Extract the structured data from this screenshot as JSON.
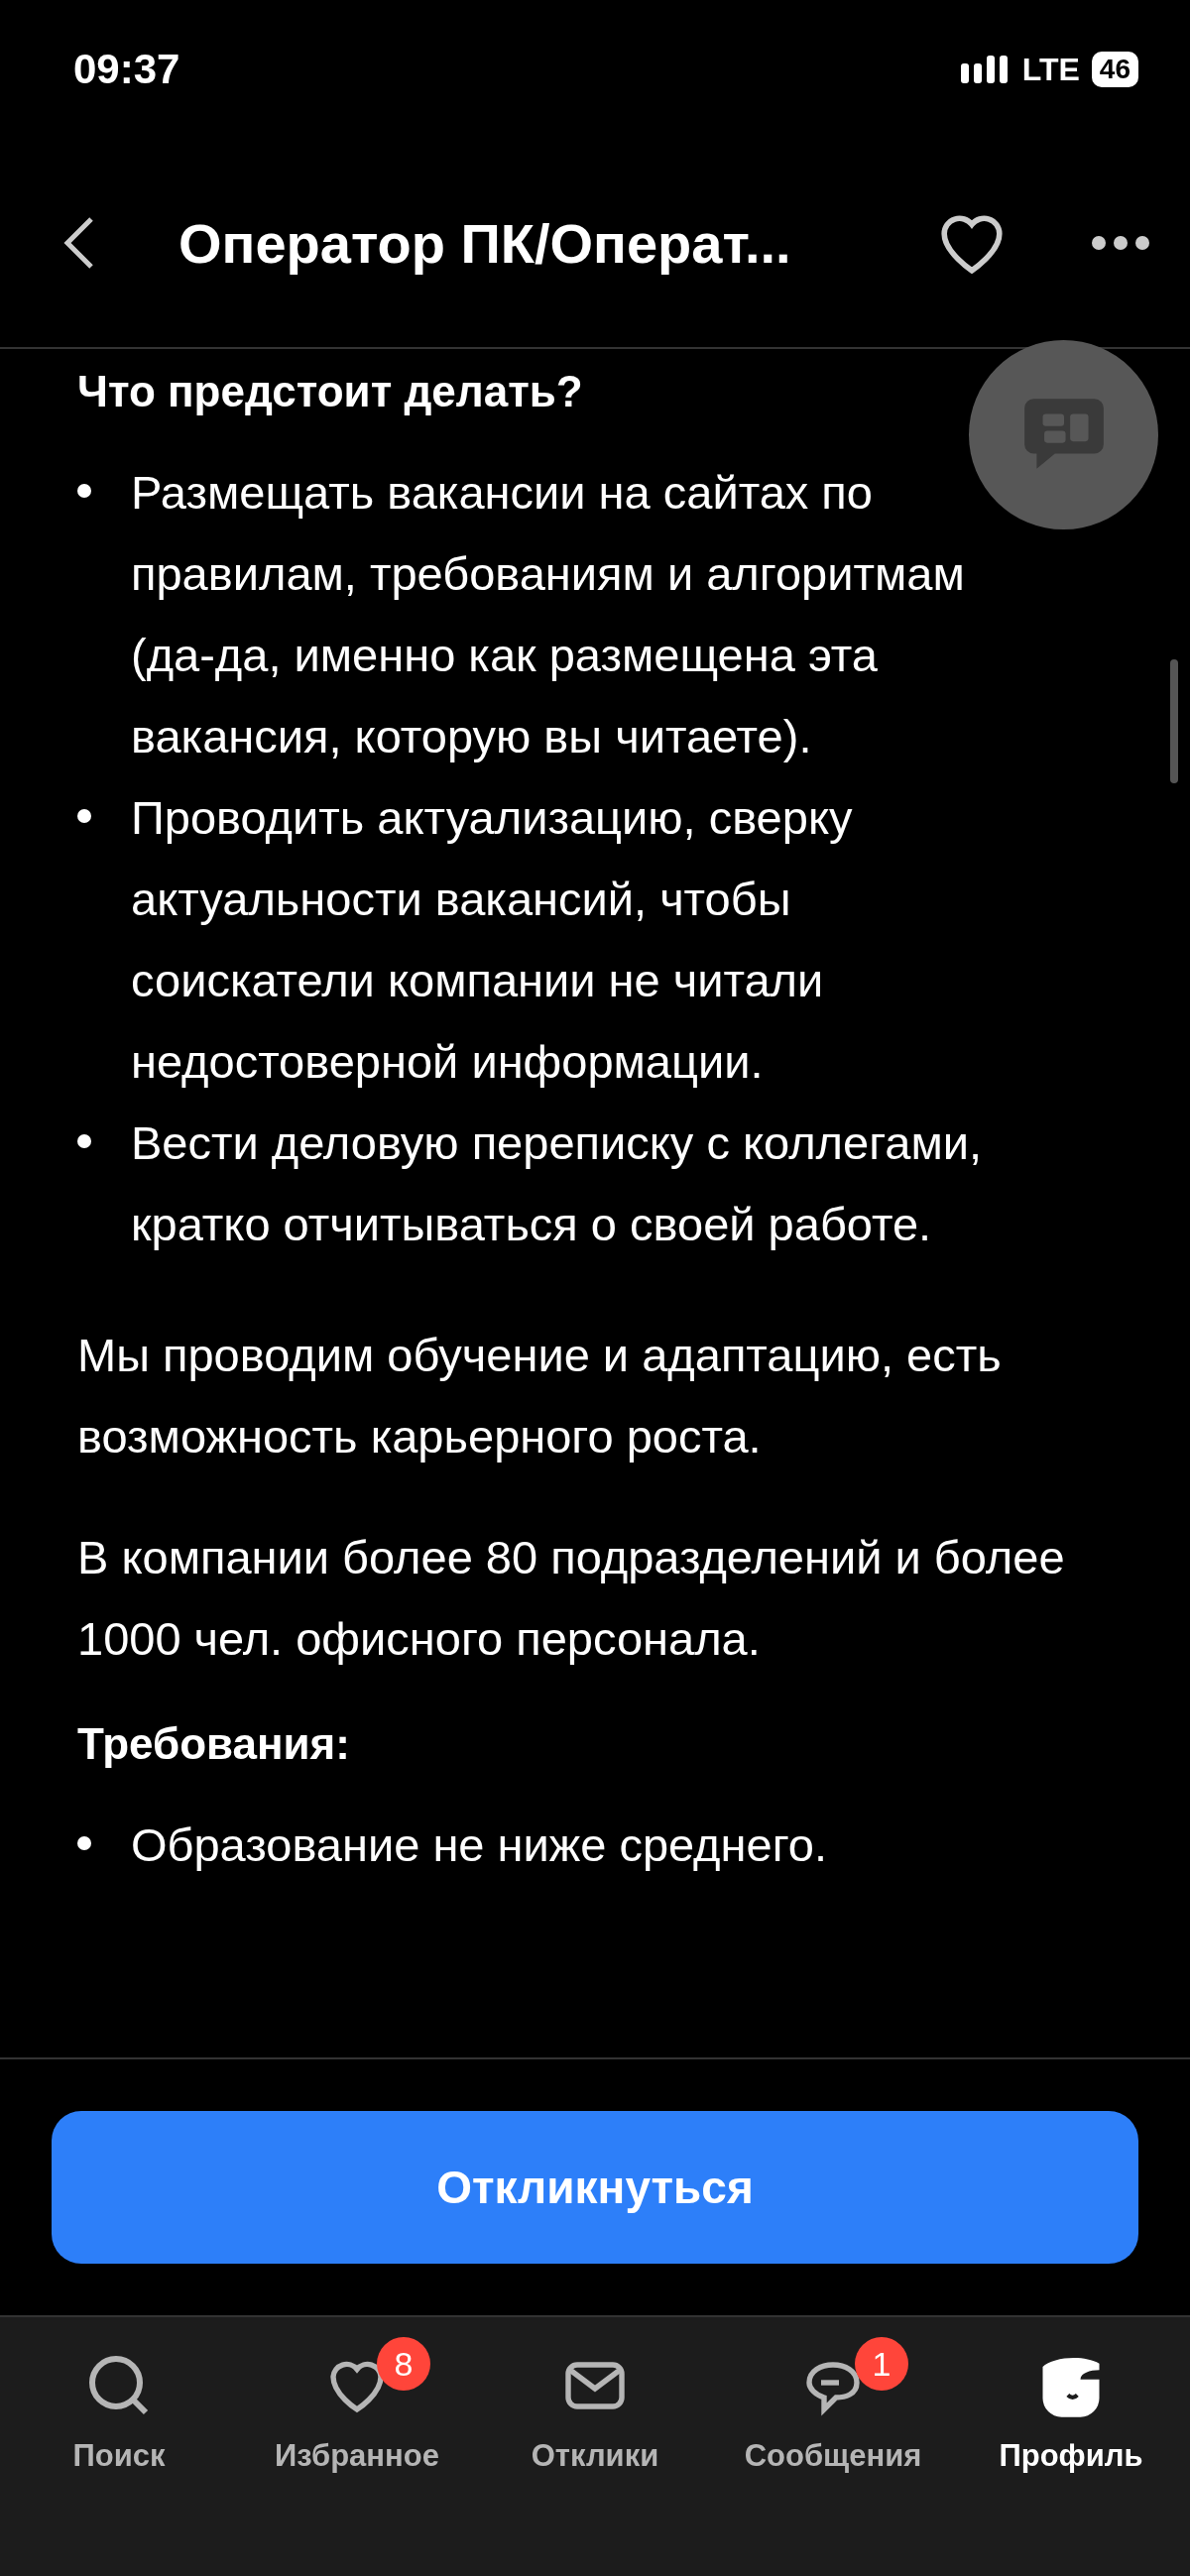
{
  "status_bar": {
    "time": "09:37",
    "network": "LTE",
    "battery": "46"
  },
  "header": {
    "title": "Оператор ПК/Операт..."
  },
  "sections": [
    {
      "kind": "heading",
      "text": "Что предстоит делать?"
    },
    {
      "kind": "list",
      "items": [
        "Размещать вакансии на сайтах по правилам, требованиям и алгоритмам (да-да, именно как размещена эта вакансия, которую вы читаете).",
        "Проводить актуализацию, сверку актуальности вакансий, чтобы соискатели компании не читали недостоверной информации.",
        "Вести деловую переписку с коллегами, кратко отчитываться о своей работе."
      ]
    },
    {
      "kind": "paragraph",
      "text": "Мы проводим обучение и адаптацию, есть возможность карьерного роста."
    },
    {
      "kind": "paragraph",
      "text": "В компании более 80 подразделений и более 1000 чел. офисного персонала."
    },
    {
      "kind": "heading",
      "text": "Требования:"
    },
    {
      "kind": "list",
      "items": [
        "Образование не ниже среднего."
      ]
    }
  ],
  "apply_button": "Откликнуться",
  "tabs": [
    {
      "kind": "search",
      "label": "Поиск",
      "selected": false
    },
    {
      "kind": "favorites",
      "label": "Избранное",
      "badge": "8",
      "selected": false
    },
    {
      "kind": "responses",
      "label": "Отклики",
      "selected": false
    },
    {
      "kind": "messages",
      "label": "Сообщения",
      "badge": "1",
      "selected": false
    },
    {
      "kind": "profile",
      "label": "Профиль",
      "selected": true
    }
  ]
}
